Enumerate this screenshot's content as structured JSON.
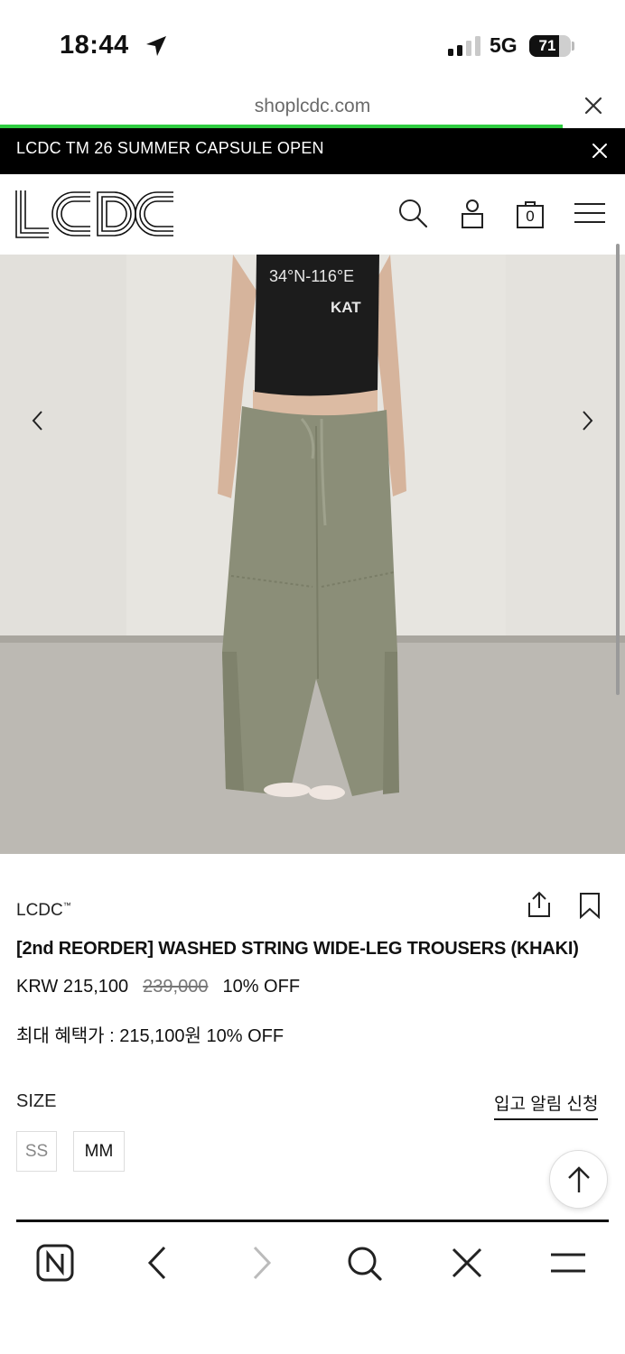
{
  "status_bar": {
    "time": "18:44",
    "network": "5G",
    "battery": "71",
    "battery_level": 0.71
  },
  "browser": {
    "url": "shoplcdc.com",
    "load_progress": 0.9
  },
  "announcement": {
    "text": "LCDC TM 26 SUMMER CAPSULE OPEN"
  },
  "header": {
    "logo": "LCDC",
    "cart_count": "0"
  },
  "product": {
    "brand": "LCDC",
    "brand_mark": "™",
    "title": "[2nd REORDER] WASHED STRING WIDE-LEG TROUSERS (KHAKI)",
    "price": "KRW 215,100",
    "original_price": "239,000",
    "discount": "10% OFF",
    "max_benefit": "최대 혜택가 : 215,100원 10% OFF",
    "image_text": {
      "shirt_line1": "34°N-116°E",
      "shirt_line2": "KAT"
    }
  },
  "size": {
    "label": "SIZE",
    "notify_label": "입고 알림 신청",
    "options": [
      "SS",
      "MM"
    ]
  },
  "icons": {
    "header": [
      "search-icon",
      "account-icon",
      "cart-icon",
      "menu-icon"
    ],
    "product": [
      "share-icon",
      "bookmark-icon"
    ],
    "toolbar": [
      "naver-home-icon",
      "back-icon",
      "forward-icon",
      "search-icon",
      "close-icon",
      "menu-icon"
    ]
  },
  "colors": {
    "progress": "#2ecc40",
    "announcement_bg": "#000000",
    "pants": "#8a8d77"
  }
}
